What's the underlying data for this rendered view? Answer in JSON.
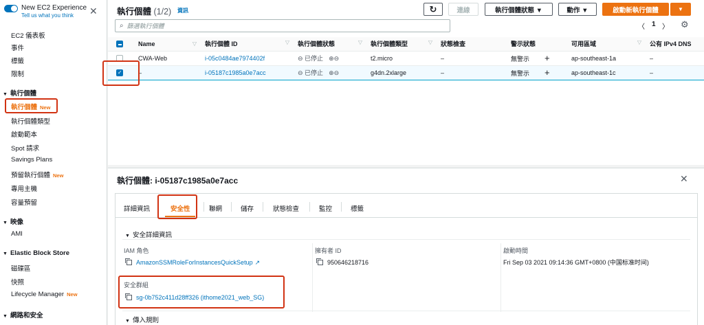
{
  "sidebar": {
    "toggle_title": "New EC2 Experience",
    "toggle_sub": "Tell us what you think",
    "close": "✕",
    "items_top": [
      "EC2 儀表板",
      "事件",
      "標籤",
      "限制"
    ],
    "section_instances": "執行個體",
    "instances_items": [
      "執行個體",
      "執行個體類型",
      "啟動範本",
      "Spot 請求",
      "Savings Plans",
      "預留執行個體",
      "專用主機",
      "容量預留"
    ],
    "new_badge": "New",
    "section_images": "映像",
    "images_items": [
      "AMI"
    ],
    "section_ebs": "Elastic Block Store",
    "ebs_items": [
      "磁碟區",
      "快照",
      "Lifecycle Manager"
    ],
    "section_network": "網路和安全"
  },
  "header": {
    "title": "執行個體",
    "count": "(1/2)",
    "info": "資訊",
    "refresh": "↻",
    "connect": "連線",
    "state_menu": "執行個體狀態 ▼",
    "actions": "動作 ▼",
    "launch": "啟動新執行個體",
    "launch_caret": "▼",
    "search_placeholder": "篩選執行個體",
    "page_prev": "〈",
    "page_num": "1",
    "page_next": "〉"
  },
  "table": {
    "columns": [
      "Name",
      "執行個體 ID",
      "執行個體狀態",
      "執行個體類型",
      "狀態檢查",
      "警示狀態",
      "可用區域",
      "公有 IPv4 DNS"
    ],
    "rows": [
      {
        "name": "CWA-Web",
        "id": "i-05c0484ae7974402f",
        "state": "已停止",
        "type": "t2.micro",
        "check": "–",
        "alarm": "無警示",
        "zone": "ap-southeast-1a",
        "dns": "–"
      },
      {
        "name": "–",
        "id": "i-05187c1985a0e7acc",
        "state": "已停止",
        "type": "g4dn.2xlarge",
        "check": "–",
        "alarm": "無警示",
        "zone": "ap-southeast-1c",
        "dns": "–"
      }
    ]
  },
  "detail": {
    "title": "執行個體: i-05187c1985a0e7acc",
    "tabs": [
      "詳細資訊",
      "安全性",
      "聯網",
      "儲存",
      "狀態檢查",
      "監控",
      "標籤"
    ],
    "section1": "安全詳細資訊",
    "iam_label": "IAM 角色",
    "iam_value": "AmazonSSMRoleForInstancesQuickSetup",
    "owner_label": "擁有者 ID",
    "owner_value": "950646218716",
    "launch_label": "啟動時間",
    "launch_value": "Fri Sep 03 2021 09:14:36 GMT+0800 (中国标准时间)",
    "sg_label": "安全群組",
    "sg_value": "sg-0b752c411d28ff326 (ithome2021_web_SG)",
    "section2": "傳入規則"
  },
  "colors": {
    "accent": "#ec7211",
    "link": "#0073bb",
    "highlight": "#d13212"
  }
}
